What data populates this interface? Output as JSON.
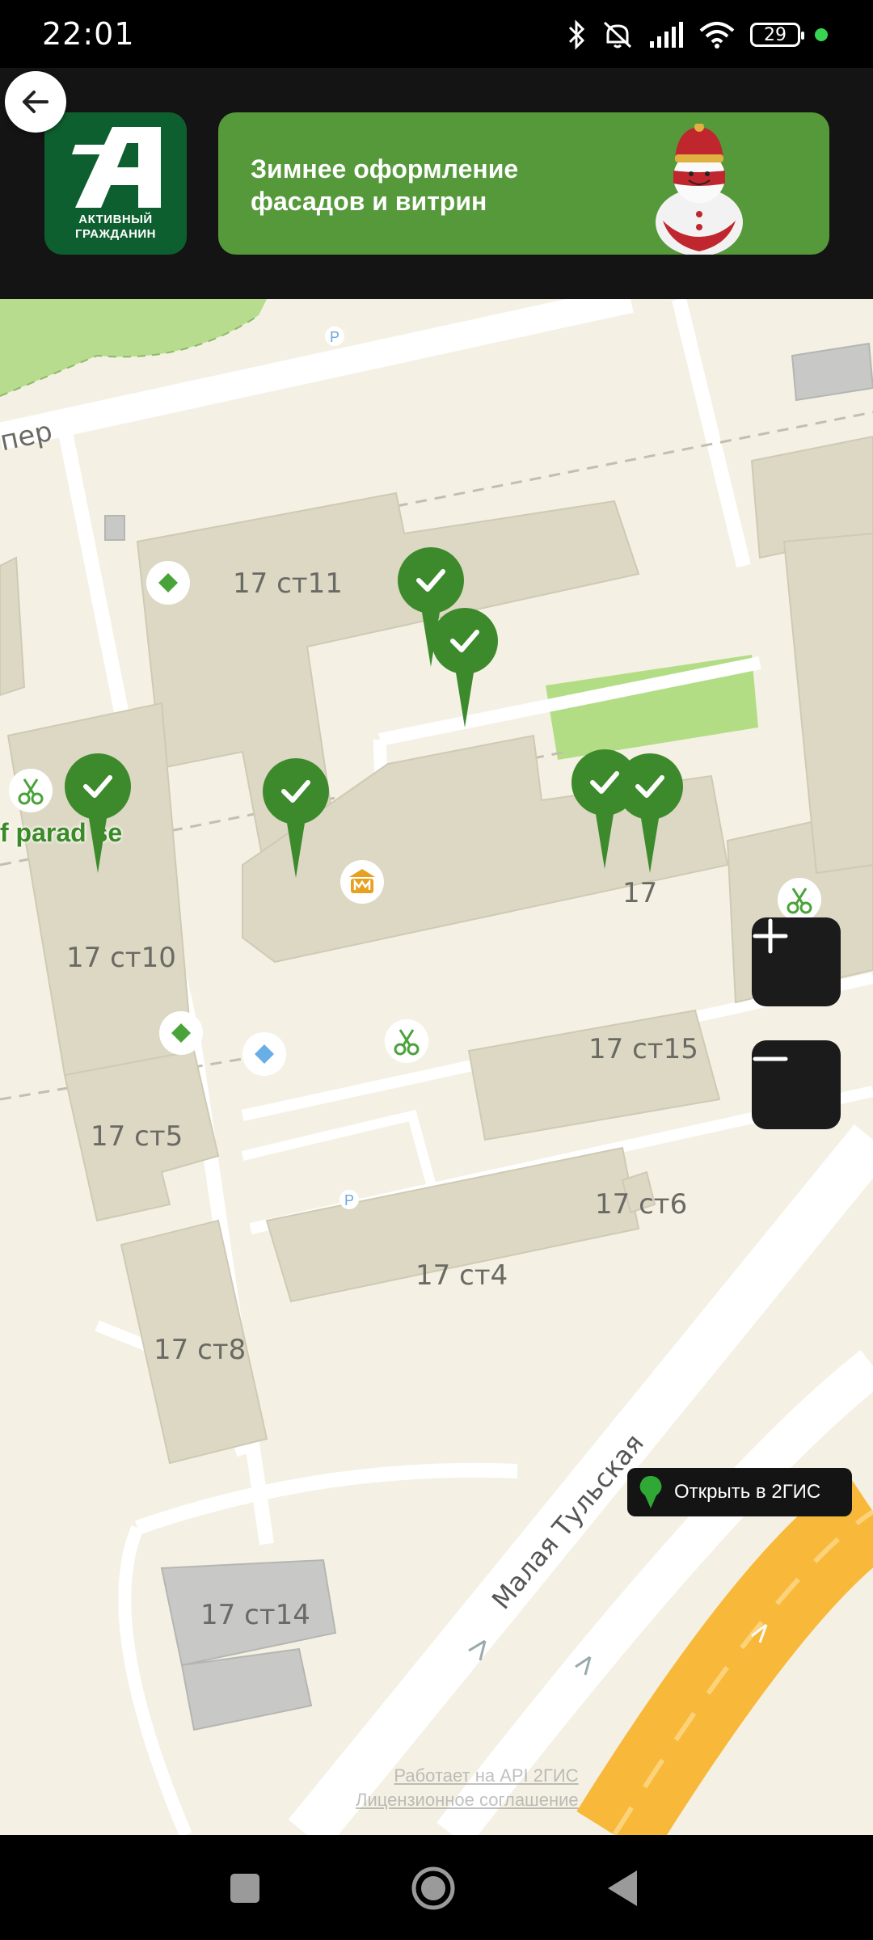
{
  "status_bar": {
    "time": "22:01",
    "battery": "29",
    "icons": [
      "bluetooth-icon",
      "mute-icon",
      "signal-icon",
      "wifi-icon",
      "battery-icon"
    ]
  },
  "header": {
    "logo_text_line1": "АКТИВНЫЙ",
    "logo_text_line2": "ГРАЖДАНИН",
    "banner_title": "Зимнее оформление фасадов и витрин",
    "brand_color": "#0e5f2f",
    "banner_color": "#55993a"
  },
  "map": {
    "buildings": [
      "17 ст11",
      "17 ст10",
      "17",
      "17 ст15",
      "17 ст5",
      "17 ст6",
      "17 ст4",
      "17 ст8",
      "17 ст14"
    ],
    "street_label": "Малая Тульская",
    "side_street_label": "пер",
    "poi_label": "f parad se",
    "attribution_line1": "Работает на API 2ГИС",
    "attribution_line2": "Лицензионное соглашение",
    "open_button_label": "Открыть в 2ГИС",
    "marker_color": "#3d8a2c"
  },
  "nav": {
    "icons": [
      "recent-apps-icon",
      "home-icon",
      "back-icon"
    ]
  }
}
